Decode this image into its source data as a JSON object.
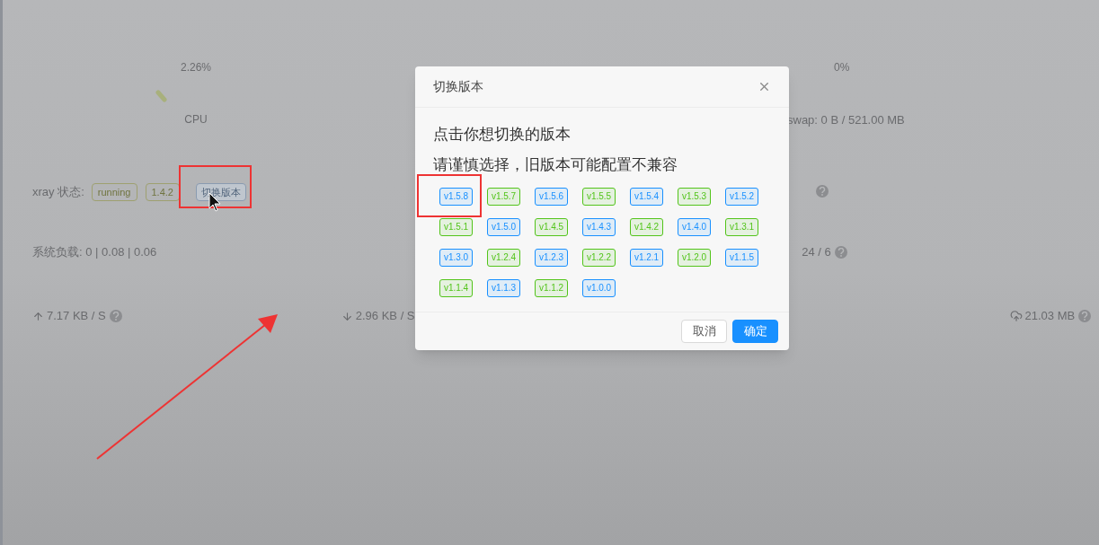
{
  "gauges": [
    {
      "value": "2.26%",
      "label": "CPU"
    },
    {
      "value": "0%",
      "label": "swap: 0 B / 521.00 MB"
    }
  ],
  "xray_status": {
    "label": "xray 状态:",
    "state": "running",
    "version": "1.4.2",
    "switch_button": "切换版本"
  },
  "system_load": "系统负载: 0 | 0.08 | 0.06",
  "cpu_cores": "24 / 6",
  "network": {
    "upload": "7.17 KB / S",
    "download": "2.96 KB / S",
    "traffic": "21.03 MB"
  },
  "dialog": {
    "title": "切换版本",
    "lines": [
      "点击你想切换的版本",
      "请谨慎选择，旧版本可能配置不兼容"
    ],
    "versions": [
      {
        "label": "v1.5.8",
        "color": "#1890ff"
      },
      {
        "label": "v1.5.7",
        "color": "#52c41a"
      },
      {
        "label": "v1.5.6",
        "color": "#1890ff"
      },
      {
        "label": "v1.5.5",
        "color": "#52c41a"
      },
      {
        "label": "v1.5.4",
        "color": "#1890ff"
      },
      {
        "label": "v1.5.3",
        "color": "#52c41a"
      },
      {
        "label": "v1.5.2",
        "color": "#1890ff"
      },
      {
        "label": "v1.5.1",
        "color": "#52c41a"
      },
      {
        "label": "v1.5.0",
        "color": "#1890ff"
      },
      {
        "label": "v1.4.5",
        "color": "#52c41a"
      },
      {
        "label": "v1.4.3",
        "color": "#1890ff"
      },
      {
        "label": "v1.4.2",
        "color": "#52c41a"
      },
      {
        "label": "v1.4.0",
        "color": "#1890ff"
      },
      {
        "label": "v1.3.1",
        "color": "#52c41a"
      },
      {
        "label": "v1.3.0",
        "color": "#1890ff"
      },
      {
        "label": "v1.2.4",
        "color": "#52c41a"
      },
      {
        "label": "v1.2.3",
        "color": "#1890ff"
      },
      {
        "label": "v1.2.2",
        "color": "#52c41a"
      },
      {
        "label": "v1.2.1",
        "color": "#1890ff"
      },
      {
        "label": "v1.2.0",
        "color": "#52c41a"
      },
      {
        "label": "v1.1.5",
        "color": "#1890ff"
      },
      {
        "label": "v1.1.4",
        "color": "#52c41a"
      },
      {
        "label": "v1.1.3",
        "color": "#1890ff"
      },
      {
        "label": "v1.1.2",
        "color": "#52c41a"
      },
      {
        "label": "v1.0.0",
        "color": "#1890ff"
      }
    ],
    "buttons": [
      {
        "label": "取消",
        "kind": "default"
      },
      {
        "label": "确定",
        "kind": "primary"
      }
    ]
  }
}
